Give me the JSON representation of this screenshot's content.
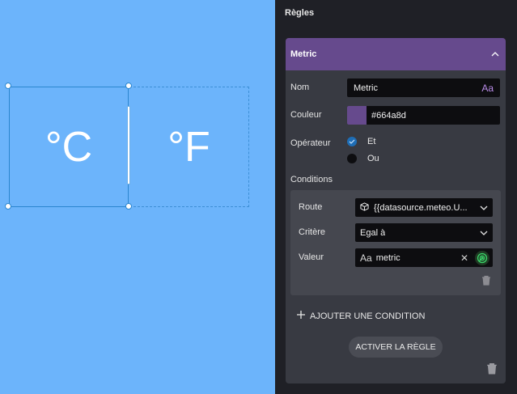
{
  "canvas": {
    "background": "#6cb4fb",
    "celsius_label": "°C",
    "fahrenheit_label": "°F"
  },
  "panel": {
    "title": "Règles",
    "rule": {
      "header_title": "Metric",
      "header_color": "#664a8d",
      "name_label": "Nom",
      "name_value": "Metric",
      "color_label": "Couleur",
      "color_value": "#664a8d",
      "operator_label": "Opérateur",
      "operators": [
        {
          "label": "Et",
          "checked": true
        },
        {
          "label": "Ou",
          "checked": false
        }
      ],
      "conditions_label": "Conditions",
      "condition": {
        "route_label": "Route",
        "route_value": "{{datasource.meteo.U...",
        "criterion_label": "Critère",
        "criterion_value": "Egal à",
        "value_label": "Valeur",
        "value_value": "metric"
      },
      "add_condition_label": "AJOUTER UNE CONDITION",
      "activate_label": "ACTIVER LA RÈGLE"
    }
  }
}
